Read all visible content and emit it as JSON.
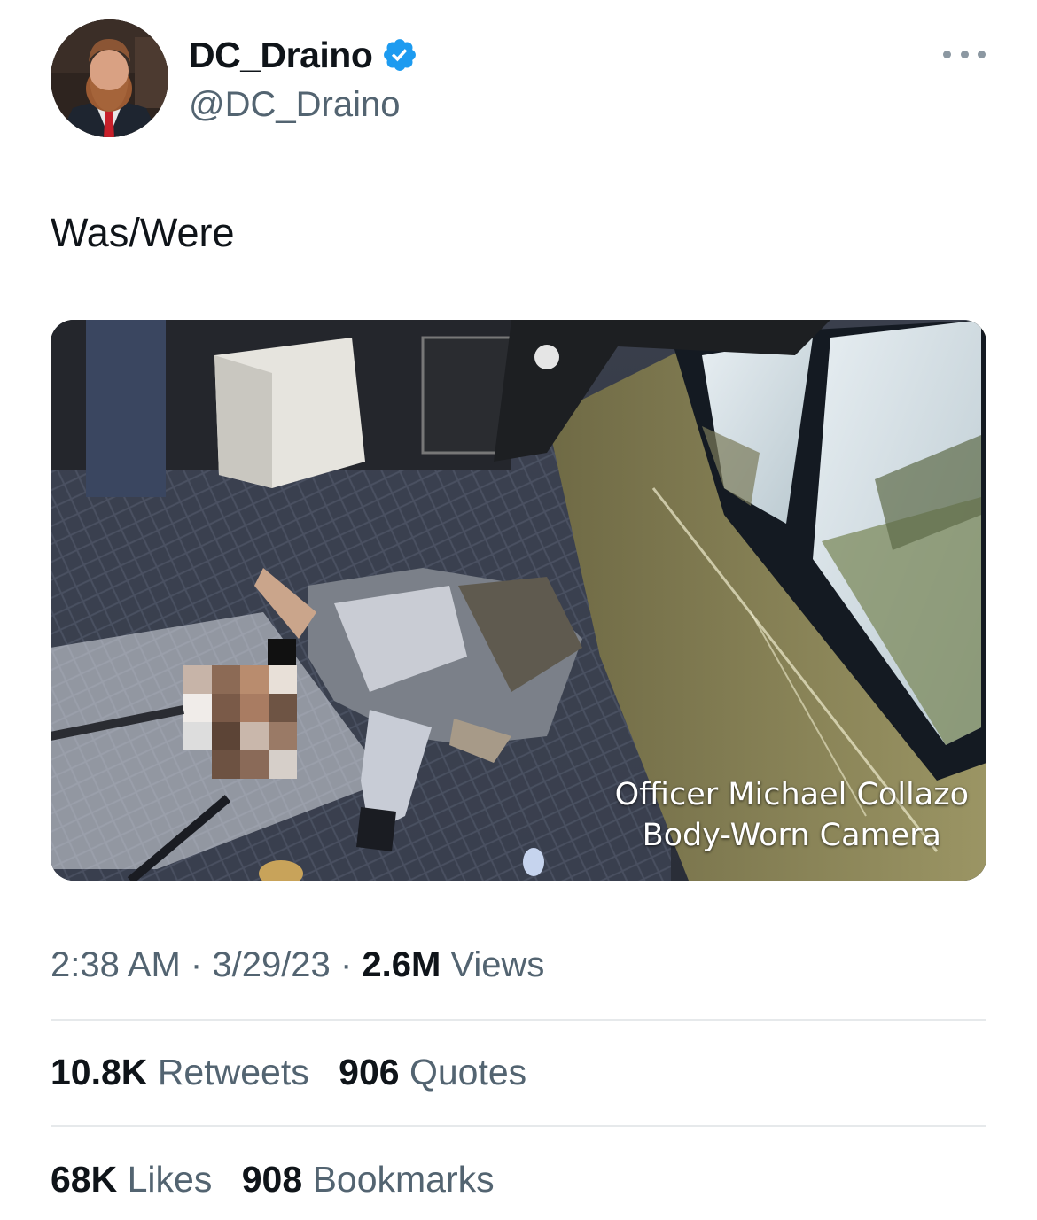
{
  "author": {
    "display_name": "DC_Draino",
    "handle": "@DC_Draino",
    "verified": true
  },
  "tweet": {
    "text": "Was/Were"
  },
  "media": {
    "caption_line1": "Officer Michael Collazo",
    "caption_line2": "Body-Worn Camera"
  },
  "meta": {
    "time": "2:38 AM",
    "separator": "·",
    "date": "3/29/23",
    "views_count": "2.6M",
    "views_label": "Views"
  },
  "engagement": {
    "retweets_count": "10.8K",
    "retweets_label": "Retweets",
    "quotes_count": "906",
    "quotes_label": "Quotes",
    "likes_count": "68K",
    "likes_label": "Likes",
    "bookmarks_count": "908",
    "bookmarks_label": "Bookmarks"
  },
  "colors": {
    "verified_blue": "#1d9bf0",
    "secondary_text": "#536471",
    "primary_text": "#0f1419"
  },
  "icons": {
    "verified": "verified-badge-icon",
    "more": "more-options-icon"
  }
}
